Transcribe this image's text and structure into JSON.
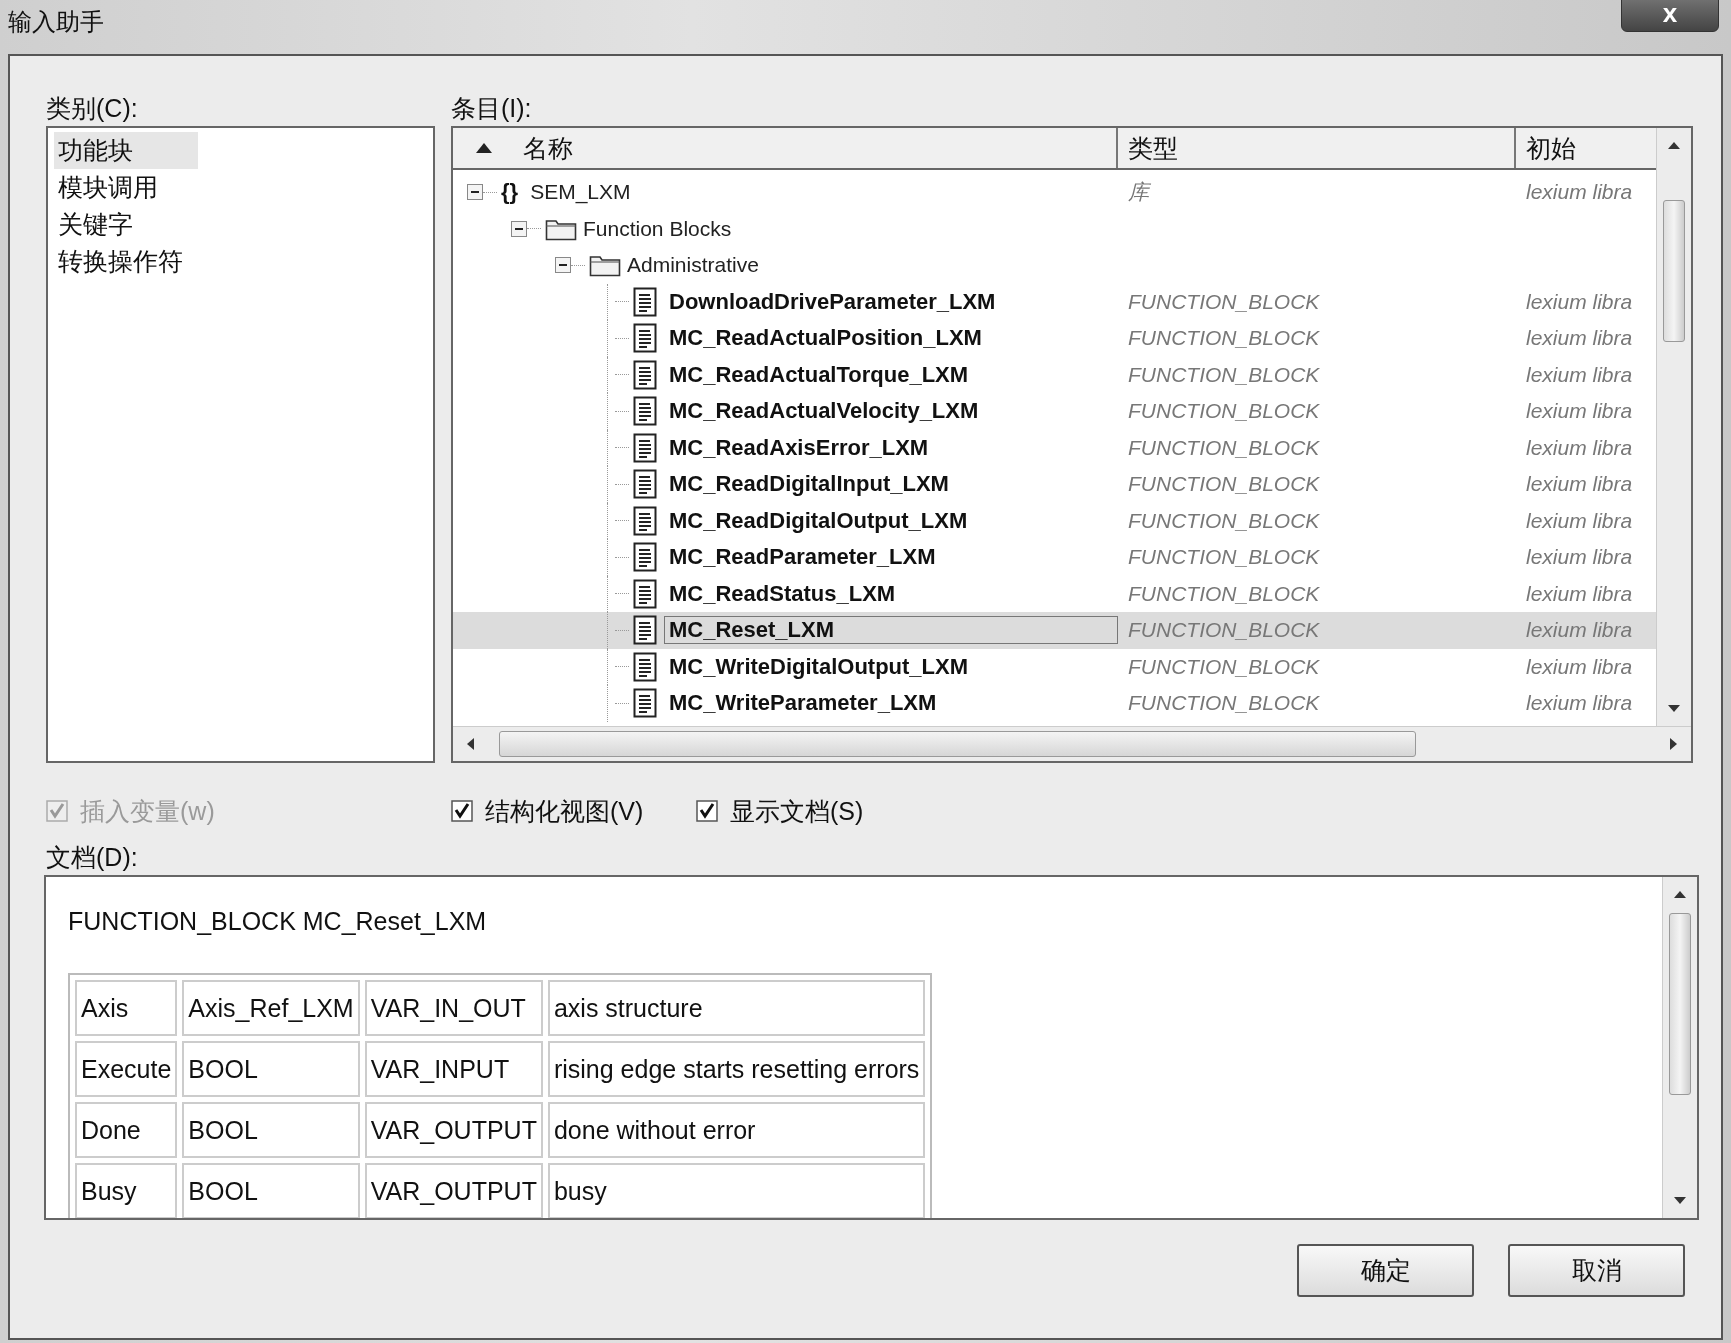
{
  "window": {
    "title": "输入助手",
    "close": "x"
  },
  "category": {
    "label": "类别(C):",
    "items": [
      {
        "label": "功能块",
        "selected": true
      },
      {
        "label": "模块调用",
        "selected": false
      },
      {
        "label": "关键字",
        "selected": false
      },
      {
        "label": "转换操作符",
        "selected": false
      }
    ]
  },
  "items": {
    "label": "条目(I):",
    "columns": [
      "名称",
      "类型",
      "初始"
    ],
    "tree": [
      {
        "label": "SEM_LXM",
        "kind": "library",
        "icon_text": "{}",
        "type": "库",
        "init": "lexium libra",
        "expanded": true,
        "selected": false,
        "children": [
          {
            "label": "Function Blocks",
            "kind": "folder",
            "expanded": true,
            "selected": false,
            "children": [
              {
                "label": "Administrative",
                "kind": "folder",
                "expanded": true,
                "selected": false,
                "children": [
                  {
                    "label": "DownloadDriveParameter_LXM",
                    "kind": "block",
                    "type": "FUNCTION_BLOCK",
                    "init": "lexium libra",
                    "selected": false
                  },
                  {
                    "label": "MC_ReadActualPosition_LXM",
                    "kind": "block",
                    "type": "FUNCTION_BLOCK",
                    "init": "lexium libra",
                    "selected": false
                  },
                  {
                    "label": "MC_ReadActualTorque_LXM",
                    "kind": "block",
                    "type": "FUNCTION_BLOCK",
                    "init": "lexium libra",
                    "selected": false
                  },
                  {
                    "label": "MC_ReadActualVelocity_LXM",
                    "kind": "block",
                    "type": "FUNCTION_BLOCK",
                    "init": "lexium libra",
                    "selected": false
                  },
                  {
                    "label": "MC_ReadAxisError_LXM",
                    "kind": "block",
                    "type": "FUNCTION_BLOCK",
                    "init": "lexium libra",
                    "selected": false
                  },
                  {
                    "label": "MC_ReadDigitalInput_LXM",
                    "kind": "block",
                    "type": "FUNCTION_BLOCK",
                    "init": "lexium libra",
                    "selected": false
                  },
                  {
                    "label": "MC_ReadDigitalOutput_LXM",
                    "kind": "block",
                    "type": "FUNCTION_BLOCK",
                    "init": "lexium libra",
                    "selected": false
                  },
                  {
                    "label": "MC_ReadParameter_LXM",
                    "kind": "block",
                    "type": "FUNCTION_BLOCK",
                    "init": "lexium libra",
                    "selected": false
                  },
                  {
                    "label": "MC_ReadStatus_LXM",
                    "kind": "block",
                    "type": "FUNCTION_BLOCK",
                    "init": "lexium libra",
                    "selected": false
                  },
                  {
                    "label": "MC_Reset_LXM",
                    "kind": "block",
                    "type": "FUNCTION_BLOCK",
                    "init": "lexium libra",
                    "selected": true
                  },
                  {
                    "label": "MC_WriteDigitalOutput_LXM",
                    "kind": "block",
                    "type": "FUNCTION_BLOCK",
                    "init": "lexium libra",
                    "selected": false
                  },
                  {
                    "label": "MC_WriteParameter_LXM",
                    "kind": "block",
                    "type": "FUNCTION_BLOCK",
                    "init": "lexium libra",
                    "selected": false
                  }
                ]
              }
            ]
          }
        ]
      }
    ]
  },
  "options": [
    {
      "label": "插入变量(w)",
      "checked": true,
      "disabled": true
    },
    {
      "label": "结构化视图(V)",
      "checked": true,
      "disabled": false
    },
    {
      "label": "显示文档(S)",
      "checked": true,
      "disabled": false
    }
  ],
  "documentation": {
    "label": "文档(D):",
    "heading": "FUNCTION_BLOCK MC_Reset_LXM",
    "table": [
      [
        "Axis",
        "Axis_Ref_LXM",
        "VAR_IN_OUT",
        "axis structure"
      ],
      [
        "Execute",
        "BOOL",
        "VAR_INPUT",
        "rising edge starts resetting errors"
      ],
      [
        "Done",
        "BOOL",
        "VAR_OUTPUT",
        "done without error"
      ],
      [
        "Busy",
        "BOOL",
        "VAR_OUTPUT",
        "busy"
      ]
    ]
  },
  "buttons": [
    {
      "label": "确定"
    },
    {
      "label": "取消"
    }
  ]
}
